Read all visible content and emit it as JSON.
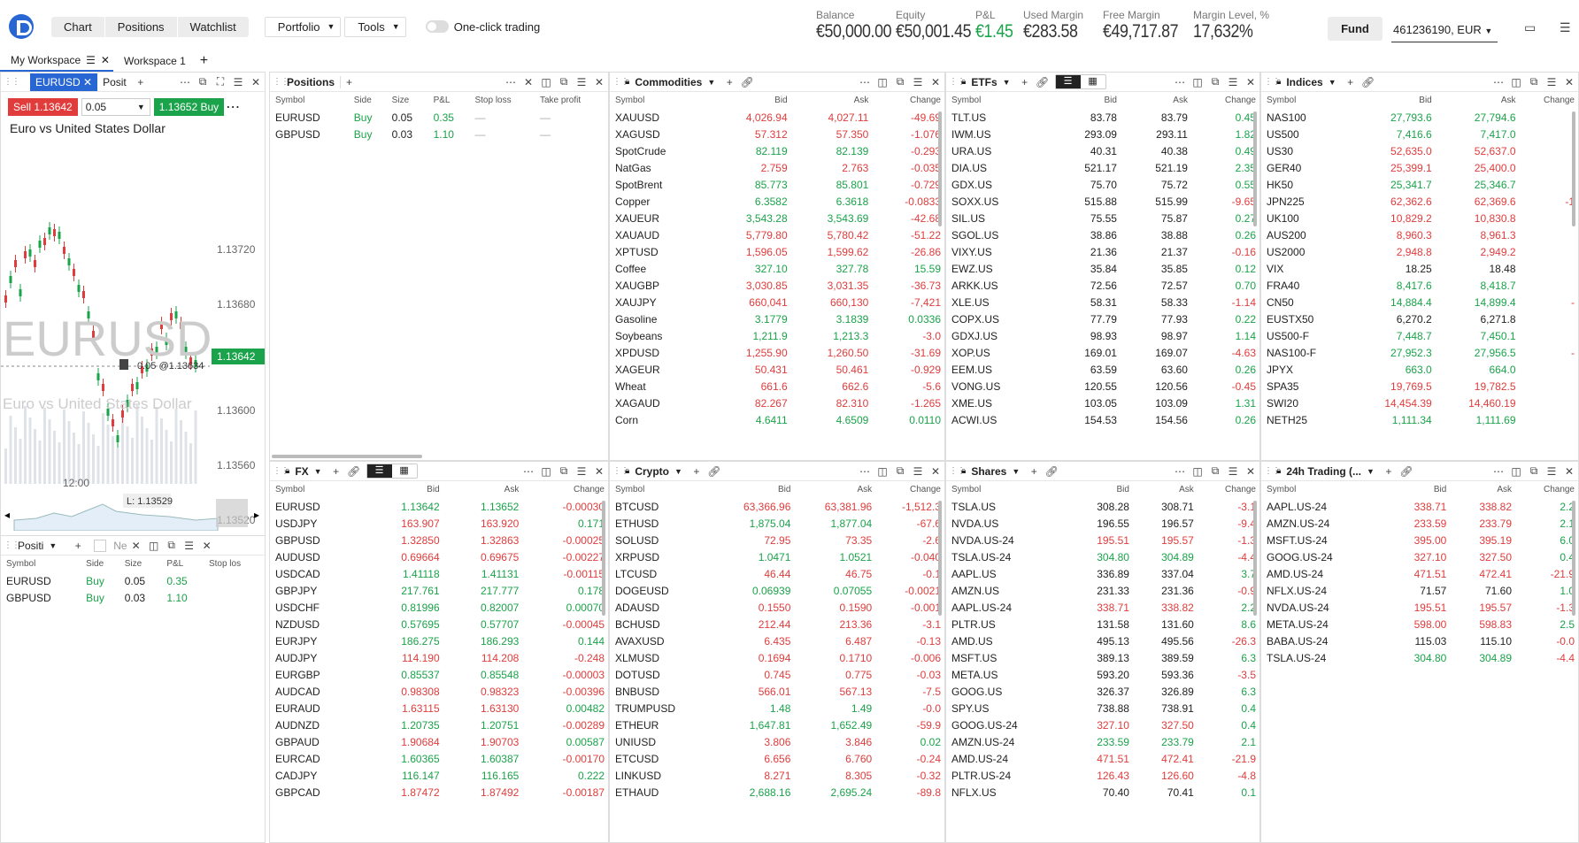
{
  "topbar": {
    "chart": "Chart",
    "positions": "Positions",
    "watchlist": "Watchlist",
    "portfolio": "Portfolio",
    "tools": "Tools",
    "oneclick": "One-click trading",
    "fund": "Fund",
    "account": "461236190, EUR"
  },
  "metrics": [
    {
      "label": "Balance",
      "value": "€50,000.00"
    },
    {
      "label": "Equity",
      "value": "€50,001.45"
    },
    {
      "label": "P&L",
      "value": "€1.45"
    },
    {
      "label": "Used Margin",
      "value": "€283.58"
    },
    {
      "label": "Free Margin",
      "value": "€49,717.87"
    },
    {
      "label": "Margin Level, %",
      "value": "17,632%"
    }
  ],
  "workspaces": [
    "My Workspace",
    "Workspace 1"
  ],
  "chart": {
    "tab": "EURUSD",
    "tab2": "Posit",
    "sell": "Sell 1.13642",
    "qty": "0.05",
    "buy": "1.13652 Buy",
    "title": "Euro vs United States Dollar",
    "watermark": "EURUSD",
    "watermark_sub": "Euro vs United States Dollar",
    "prices": [
      "1.13720",
      "1.13680",
      "1.13642",
      "1.13600",
      "1.13560",
      "1.13520"
    ],
    "order": "0.05 @1.13634",
    "low": "L: 1.13529",
    "time": "12:00"
  },
  "positions_small": {
    "title": "Positi",
    "cols": [
      "Symbol",
      "Side",
      "Size",
      "P&L",
      "Stop los"
    ],
    "rows": [
      [
        "EURUSD",
        "Buy",
        "0.05",
        "0.35"
      ],
      [
        "GBPUSD",
        "Buy",
        "0.03",
        "1.10"
      ]
    ],
    "search": "Ne"
  },
  "positions": {
    "title": "Positions",
    "cols": [
      "Symbol",
      "Side",
      "Size",
      "P&L",
      "Stop loss",
      "Take profit"
    ],
    "rows": [
      [
        "EURUSD",
        "Buy",
        "0.05",
        "0.35",
        "—",
        "—"
      ],
      [
        "GBPUSD",
        "Buy",
        "0.03",
        "1.10",
        "—",
        "—"
      ]
    ]
  },
  "cols": [
    "Symbol",
    "Bid",
    "Ask",
    "Change"
  ],
  "commodities": {
    "title": "Commodities",
    "rows": [
      [
        "XAUUSD",
        "4,026.94",
        "4,027.11",
        "-49.69",
        "r"
      ],
      [
        "XAGUSD",
        "57.312",
        "57.350",
        "-1.076",
        "r"
      ],
      [
        "SpotCrude",
        "82.119",
        "82.139",
        "-0.293",
        "g"
      ],
      [
        "NatGas",
        "2.759",
        "2.763",
        "-0.035",
        "r"
      ],
      [
        "SpotBrent",
        "85.773",
        "85.801",
        "-0.729",
        "g"
      ],
      [
        "Copper",
        "6.3582",
        "6.3618",
        "-0.0833",
        "g"
      ],
      [
        "XAUEUR",
        "3,543.28",
        "3,543.69",
        "-42.68",
        "g"
      ],
      [
        "XAUAUD",
        "5,779.80",
        "5,780.42",
        "-51.22",
        "r"
      ],
      [
        "XPTUSD",
        "1,596.05",
        "1,599.62",
        "-26.86",
        "r"
      ],
      [
        "Coffee",
        "327.10",
        "327.78",
        "15.59",
        "g"
      ],
      [
        "XAUGBP",
        "3,030.85",
        "3,031.35",
        "-36.73",
        "r"
      ],
      [
        "XAUJPY",
        "660,041",
        "660,130",
        "-7,421",
        "r"
      ],
      [
        "Gasoline",
        "3.1779",
        "3.1839",
        "0.0336",
        "g"
      ],
      [
        "Soybeans",
        "1,211.9",
        "1,213.3",
        "-3.0",
        "g"
      ],
      [
        "XPDUSD",
        "1,255.90",
        "1,260.50",
        "-31.69",
        "r"
      ],
      [
        "XAGEUR",
        "50.431",
        "50.461",
        "-0.929",
        "r"
      ],
      [
        "Wheat",
        "661.6",
        "662.6",
        "-5.6",
        "r"
      ],
      [
        "XAGAUD",
        "82.267",
        "82.310",
        "-1.265",
        "r"
      ],
      [
        "Corn",
        "4.6411",
        "4.6509",
        "0.0110",
        "g"
      ]
    ]
  },
  "etfs": {
    "title": "ETFs",
    "rows": [
      [
        "TLT.US",
        "83.78",
        "83.79",
        "0.45",
        "b"
      ],
      [
        "IWM.US",
        "293.09",
        "293.11",
        "1.82",
        "b"
      ],
      [
        "URA.US",
        "40.31",
        "40.38",
        "0.49",
        "b"
      ],
      [
        "DIA.US",
        "521.17",
        "521.19",
        "2.35",
        "b"
      ],
      [
        "GDX.US",
        "75.70",
        "75.72",
        "0.55",
        "b"
      ],
      [
        "SOXX.US",
        "515.88",
        "515.99",
        "-9.65",
        "b"
      ],
      [
        "SIL.US",
        "75.55",
        "75.87",
        "0.27",
        "b"
      ],
      [
        "SGOL.US",
        "38.86",
        "38.88",
        "0.26",
        "b"
      ],
      [
        "VIXY.US",
        "21.36",
        "21.37",
        "-0.16",
        "b"
      ],
      [
        "EWZ.US",
        "35.84",
        "35.85",
        "0.12",
        "b"
      ],
      [
        "ARKK.US",
        "72.56",
        "72.57",
        "0.70",
        "b"
      ],
      [
        "XLE.US",
        "58.31",
        "58.33",
        "-1.14",
        "b"
      ],
      [
        "COPX.US",
        "77.79",
        "77.93",
        "0.22",
        "b"
      ],
      [
        "GDXJ.US",
        "98.93",
        "98.97",
        "1.14",
        "b"
      ],
      [
        "XOP.US",
        "169.01",
        "169.07",
        "-4.63",
        "b"
      ],
      [
        "EEM.US",
        "63.59",
        "63.60",
        "0.26",
        "b"
      ],
      [
        "VONG.US",
        "120.55",
        "120.56",
        "-0.45",
        "b"
      ],
      [
        "XME.US",
        "103.05",
        "103.09",
        "1.31",
        "b"
      ],
      [
        "ACWI.US",
        "154.53",
        "154.56",
        "0.26",
        "b"
      ]
    ]
  },
  "indices": {
    "title": "Indices",
    "rows": [
      [
        "NAS100",
        "27,793.6",
        "27,794.6",
        "",
        "g"
      ],
      [
        "US500",
        "7,416.6",
        "7,417.0",
        "",
        "g"
      ],
      [
        "US30",
        "52,635.0",
        "52,637.0",
        "",
        "r"
      ],
      [
        "GER40",
        "25,399.1",
        "25,400.0",
        "",
        "r"
      ],
      [
        "HK50",
        "25,341.7",
        "25,346.7",
        "",
        "g"
      ],
      [
        "JPN225",
        "62,362.6",
        "62,369.6",
        "-1",
        "r"
      ],
      [
        "UK100",
        "10,829.2",
        "10,830.8",
        "",
        "r"
      ],
      [
        "AUS200",
        "8,960.3",
        "8,961.3",
        "",
        "r"
      ],
      [
        "US2000",
        "2,948.8",
        "2,949.2",
        "",
        "r"
      ],
      [
        "VIX",
        "18.25",
        "18.48",
        "",
        "b"
      ],
      [
        "FRA40",
        "8,417.6",
        "8,418.7",
        "",
        "g"
      ],
      [
        "CN50",
        "14,884.4",
        "14,899.4",
        "-",
        "g"
      ],
      [
        "EUSTX50",
        "6,270.2",
        "6,271.8",
        "",
        "b"
      ],
      [
        "US500-F",
        "7,448.7",
        "7,450.1",
        "",
        "g"
      ],
      [
        "NAS100-F",
        "27,952.3",
        "27,956.5",
        "-",
        "g"
      ],
      [
        "JPYX",
        "663.0",
        "664.0",
        "",
        "g"
      ],
      [
        "SPA35",
        "19,769.5",
        "19,782.5",
        "",
        "r"
      ],
      [
        "SWI20",
        "14,454.39",
        "14,460.19",
        "",
        "r"
      ],
      [
        "NETH25",
        "1,111.34",
        "1,111.69",
        "",
        "g"
      ]
    ]
  },
  "fx": {
    "title": "FX",
    "rows": [
      [
        "EURUSD",
        "1.13642",
        "1.13652",
        "-0.00030",
        "g"
      ],
      [
        "USDJPY",
        "163.907",
        "163.920",
        "0.171",
        "r"
      ],
      [
        "GBPUSD",
        "1.32850",
        "1.32863",
        "-0.00025",
        "r"
      ],
      [
        "AUDUSD",
        "0.69664",
        "0.69675",
        "-0.00227",
        "r"
      ],
      [
        "USDCAD",
        "1.41118",
        "1.41131",
        "-0.00115",
        "g"
      ],
      [
        "GBPJPY",
        "217.761",
        "217.777",
        "0.178",
        "g"
      ],
      [
        "USDCHF",
        "0.81996",
        "0.82007",
        "0.00070",
        "g"
      ],
      [
        "NZDUSD",
        "0.57695",
        "0.57707",
        "-0.00045",
        "g"
      ],
      [
        "EURJPY",
        "186.275",
        "186.293",
        "0.144",
        "g"
      ],
      [
        "AUDJPY",
        "114.190",
        "114.208",
        "-0.248",
        "r"
      ],
      [
        "EURGBP",
        "0.85537",
        "0.85548",
        "-0.00003",
        "g"
      ],
      [
        "AUDCAD",
        "0.98308",
        "0.98323",
        "-0.00396",
        "r"
      ],
      [
        "EURAUD",
        "1.63115",
        "1.63130",
        "0.00482",
        "r"
      ],
      [
        "AUDNZD",
        "1.20735",
        "1.20751",
        "-0.00289",
        "g"
      ],
      [
        "GBPAUD",
        "1.90684",
        "1.90703",
        "0.00587",
        "r"
      ],
      [
        "EURCAD",
        "1.60365",
        "1.60387",
        "-0.00170",
        "g"
      ],
      [
        "CADJPY",
        "116.147",
        "116.165",
        "0.222",
        "g"
      ],
      [
        "GBPCAD",
        "1.87472",
        "1.87492",
        "-0.00187",
        "r"
      ]
    ]
  },
  "crypto": {
    "title": "Crypto",
    "rows": [
      [
        "BTCUSD",
        "63,366.96",
        "63,381.96",
        "-1,512.3",
        "r"
      ],
      [
        "ETHUSD",
        "1,875.04",
        "1,877.04",
        "-67.6",
        "g"
      ],
      [
        "SOLUSD",
        "72.95",
        "73.35",
        "-2.6",
        "r"
      ],
      [
        "XRPUSD",
        "1.0471",
        "1.0521",
        "-0.040",
        "g"
      ],
      [
        "LTCUSD",
        "46.44",
        "46.75",
        "-0.1",
        "r"
      ],
      [
        "DOGEUSD",
        "0.06939",
        "0.07055",
        "-0.0021",
        "g"
      ],
      [
        "ADAUSD",
        "0.1550",
        "0.1590",
        "-0.001",
        "r"
      ],
      [
        "BCHUSD",
        "212.44",
        "213.36",
        "-3.1",
        "r"
      ],
      [
        "AVAXUSD",
        "6.435",
        "6.487",
        "-0.13",
        "r"
      ],
      [
        "XLMUSD",
        "0.1694",
        "0.1710",
        "-0.006",
        "r"
      ],
      [
        "DOTUSD",
        "0.745",
        "0.775",
        "-0.03",
        "r"
      ],
      [
        "BNBUSD",
        "566.01",
        "567.13",
        "-7.5",
        "r"
      ],
      [
        "TRUMPUSD",
        "1.48",
        "1.49",
        "-0.0",
        "g"
      ],
      [
        "ETHEUR",
        "1,647.81",
        "1,652.49",
        "-59.9",
        "g"
      ],
      [
        "UNIUSD",
        "3.806",
        "3.846",
        "0.02",
        "r"
      ],
      [
        "ETCUSD",
        "6.656",
        "6.760",
        "-0.24",
        "r"
      ],
      [
        "LINKUSD",
        "8.271",
        "8.305",
        "-0.32",
        "r"
      ],
      [
        "ETHAUD",
        "2,688.16",
        "2,695.24",
        "-89.8",
        "g"
      ]
    ]
  },
  "shares": {
    "title": "Shares",
    "rows": [
      [
        "TSLA.US",
        "308.28",
        "308.71",
        "-3.1",
        "b"
      ],
      [
        "NVDA.US",
        "196.55",
        "196.57",
        "-9.4",
        "b"
      ],
      [
        "NVDA.US-24",
        "195.51",
        "195.57",
        "-1.3",
        "r"
      ],
      [
        "TSLA.US-24",
        "304.80",
        "304.89",
        "-4.4",
        "g"
      ],
      [
        "AAPL.US",
        "336.89",
        "337.04",
        "3.7",
        "b"
      ],
      [
        "AMZN.US",
        "231.33",
        "231.36",
        "-0.9",
        "b"
      ],
      [
        "AAPL.US-24",
        "338.71",
        "338.82",
        "2.2",
        "r"
      ],
      [
        "PLTR.US",
        "131.58",
        "131.60",
        "8.6",
        "b"
      ],
      [
        "AMD.US",
        "495.13",
        "495.56",
        "-26.3",
        "b"
      ],
      [
        "MSFT.US",
        "389.13",
        "389.59",
        "6.3",
        "b"
      ],
      [
        "META.US",
        "593.20",
        "593.36",
        "-3.5",
        "b"
      ],
      [
        "GOOG.US",
        "326.37",
        "326.89",
        "6.3",
        "b"
      ],
      [
        "SPY.US",
        "738.88",
        "738.91",
        "0.4",
        "b"
      ],
      [
        "GOOG.US-24",
        "327.10",
        "327.50",
        "0.4",
        "r"
      ],
      [
        "AMZN.US-24",
        "233.59",
        "233.79",
        "2.1",
        "g"
      ],
      [
        "AMD.US-24",
        "471.51",
        "472.41",
        "-21.9",
        "r"
      ],
      [
        "PLTR.US-24",
        "126.43",
        "126.60",
        "-4.8",
        "r"
      ],
      [
        "NFLX.US",
        "70.40",
        "70.41",
        "0.1",
        "b"
      ]
    ]
  },
  "trading24": {
    "title": "24h Trading (...",
    "rows": [
      [
        "AAPL.US-24",
        "338.71",
        "338.82",
        "2.2",
        "r"
      ],
      [
        "AMZN.US-24",
        "233.59",
        "233.79",
        "2.1",
        "r"
      ],
      [
        "MSFT.US-24",
        "395.00",
        "395.19",
        "6.0",
        "r"
      ],
      [
        "GOOG.US-24",
        "327.10",
        "327.50",
        "0.4",
        "r"
      ],
      [
        "AMD.US-24",
        "471.51",
        "472.41",
        "-21.9",
        "r"
      ],
      [
        "NFLX.US-24",
        "71.57",
        "71.60",
        "1.0",
        "b"
      ],
      [
        "NVDA.US-24",
        "195.51",
        "195.57",
        "-1.3",
        "r"
      ],
      [
        "META.US-24",
        "598.00",
        "598.83",
        "2.5",
        "r"
      ],
      [
        "BABA.US-24",
        "115.03",
        "115.10",
        "-0.0",
        "b"
      ],
      [
        "TSLA.US-24",
        "304.80",
        "304.89",
        "-4.4",
        "g"
      ]
    ]
  },
  "colors": {
    "red": "#e03c3c",
    "green": "#1aa34a",
    "blue": "#2867d3"
  }
}
